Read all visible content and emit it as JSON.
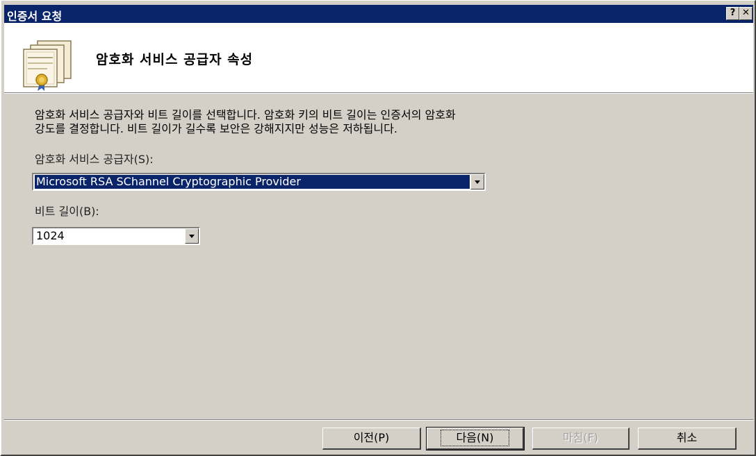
{
  "window": {
    "title": "인증서 요청",
    "help_glyph": "?",
    "close_glyph": "✕"
  },
  "header": {
    "title": "암호화 서비스 공급자 속성",
    "icon": "certificate-icon"
  },
  "body": {
    "description_line1": "암호화 서비스 공급자와 비트 길이를 선택합니다. 암호화 키의 비트 길이는 인증서의 암호화",
    "description_line2": "강도를 결정합니다. 비트 길이가 길수록 보안은 강해지지만 성능은 저하됩니다.",
    "provider_label": "암호화 서비스 공급자(S):",
    "provider_value": "Microsoft RSA SChannel Cryptographic Provider",
    "bits_label": "비트 길이(B):",
    "bits_value": "1024"
  },
  "footer": {
    "back_label": "이전(P)",
    "next_label": "다음(N)",
    "finish_label": "마침(F)",
    "cancel_label": "취소"
  },
  "colors": {
    "titlebar": "#0a246a",
    "face": "#d4d0c8",
    "selection": "#0a246a"
  }
}
